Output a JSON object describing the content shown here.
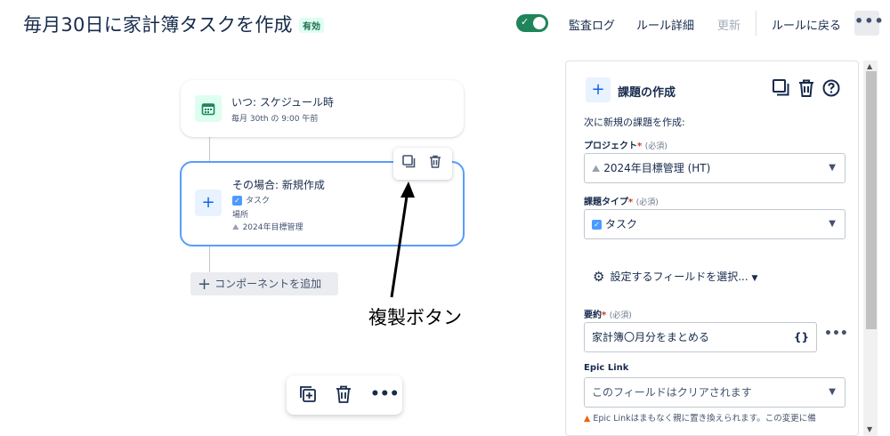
{
  "header": {
    "title": "毎月30日に家計簿タスクを作成",
    "status_badge": "有効",
    "toggle_check": "✓",
    "links": {
      "audit_log": "監査ログ",
      "rule_details": "ルール詳細",
      "update": "更新",
      "back": "ルールに戻る"
    },
    "more": "•••"
  },
  "canvas": {
    "trigger": {
      "title": "いつ: スケジュール時",
      "subtitle": "毎月 30th の 9:00 午前",
      "icon": "calendar-icon"
    },
    "action": {
      "title": "その場合: 新規作成",
      "issue_type": "タスク",
      "location_label": "場所",
      "project": "2024年目標管理",
      "icon": "plus-icon"
    },
    "add_component": "コンポーネントを追加",
    "annotation": "複製ボタン",
    "bottom_more": "•••"
  },
  "panel": {
    "title": "課題の作成",
    "description": "次に新規の課題を作成:",
    "project_label": "プロジェクト",
    "required_mark": "*",
    "required_note": "(必須)",
    "project_value": "2024年目標管理 (HT)",
    "issue_type_label": "課題タイプ",
    "issue_type_value": "タスク",
    "fields_button": "設定するフィールドを選択...",
    "summary_label": "要約",
    "summary_value": "家計簿〇月分をまとめる",
    "braces": "{}",
    "summary_more": "•••",
    "epic_link_label": "Epic Link",
    "epic_link_placeholder": "このフィールドはクリアされます",
    "warning": "Epic Linkはまもなく親に置き換えられます。この変更に備"
  },
  "colors": {
    "accent": "#0c66e4",
    "toggle_on": "#1f845a",
    "selected_border": "#579dff"
  }
}
